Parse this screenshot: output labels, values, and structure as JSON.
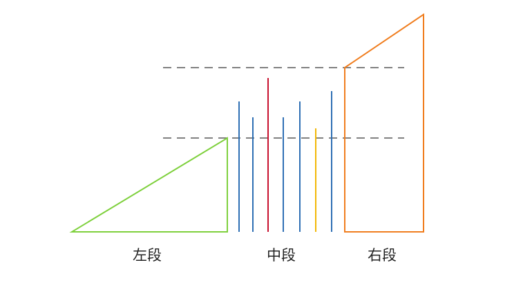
{
  "labels": {
    "left": "左段",
    "middle": "中段",
    "right": "右段"
  },
  "colors": {
    "left_shape": "#7ed03c",
    "right_shape": "#f07d1e",
    "bars_default": "#2e6fb4",
    "bar_highlight_red": "#c8102e",
    "bar_highlight_yellow": "#f2b705",
    "dashed_lines": "#808080"
  },
  "middle_bars": {
    "count": 7,
    "colors": [
      "blue",
      "blue",
      "red",
      "blue",
      "blue",
      "yellow",
      "blue"
    ]
  }
}
